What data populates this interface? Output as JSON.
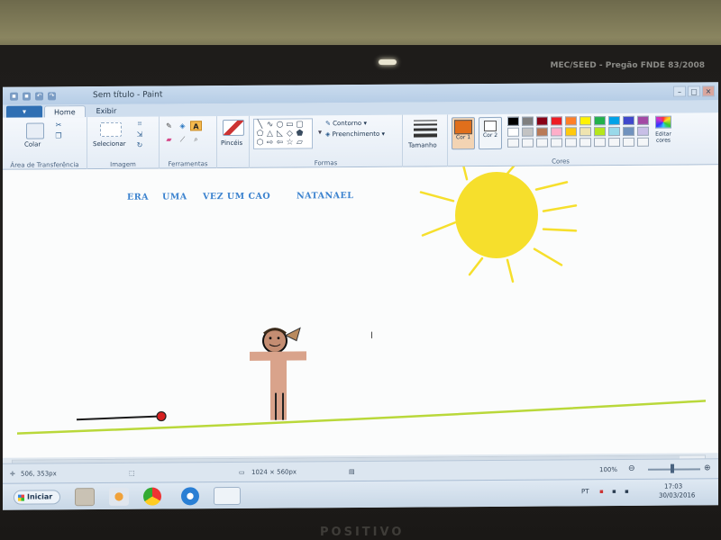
{
  "monitor": {
    "label": "MEC/SEED - Pregão FNDE 83/2008",
    "brand": "POSITIVO"
  },
  "window": {
    "title": "Sem título - Paint",
    "controls": [
      "–",
      "□",
      "✕"
    ]
  },
  "ribbon": {
    "menu_button": "",
    "tabs": [
      {
        "label": "Home",
        "active": true
      },
      {
        "label": "Exibir",
        "active": false
      }
    ],
    "groups": {
      "clipboard": {
        "paste": "Colar",
        "label": "Área de Transferência"
      },
      "image": {
        "select": "Selecionar",
        "label": "Imagem"
      },
      "tools": {
        "label": "Ferramentas"
      },
      "brushes": {
        "label": "Pincéis"
      },
      "shapes": {
        "outline": "Contorno",
        "fill": "Preenchimento",
        "label": "Formas"
      },
      "size": {
        "label": "Tamanho"
      },
      "colors": {
        "color1": "Cor 1",
        "color2": "Cor 2",
        "edit": "Editar cores",
        "label": "Cores",
        "color1_value": "#e06f1c",
        "color2_value": "#ffffff",
        "palette_row1": [
          "#000000",
          "#7f7f7f",
          "#880015",
          "#ed1c24",
          "#ff7f27",
          "#fff200",
          "#22b14c",
          "#00a2e8",
          "#3f48cc",
          "#a349a4"
        ],
        "palette_row2": [
          "#ffffff",
          "#c3c3c3",
          "#b97a57",
          "#ffaec9",
          "#ffc90e",
          "#efe4b0",
          "#b5e61d",
          "#99d9ea",
          "#7092be",
          "#c8bfe7"
        ]
      }
    }
  },
  "canvas": {
    "texts": [
      "ERA",
      "UMA",
      "VEZ UM CAO",
      "NATANAEL"
    ],
    "text_color": "#3c83cf",
    "sun_color": "#f6df2c",
    "ground_color": "#b9d83a",
    "person_skin": "#d9a38b"
  },
  "status": {
    "cursor_pos": "506, 353px",
    "canvas_size": "1024 × 560px",
    "zoom": "100%"
  },
  "taskbar": {
    "start_label": "Iniciar",
    "language": "PT",
    "time": "17:03",
    "date": "30/03/2016"
  }
}
